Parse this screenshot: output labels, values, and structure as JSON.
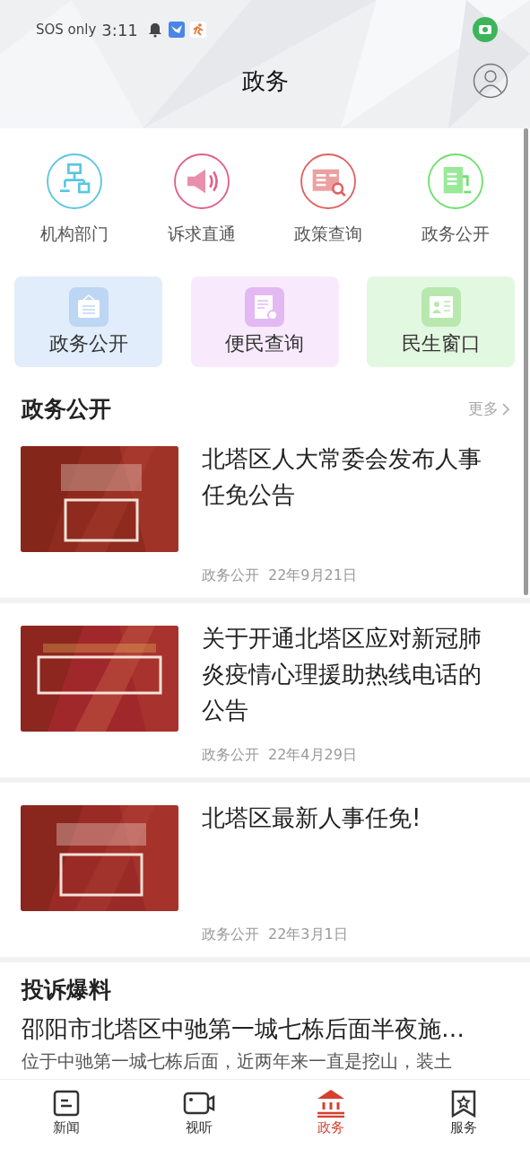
{
  "status_bar": {
    "carrier": "SOS only",
    "time": "3:11"
  },
  "header": {
    "title": "政务"
  },
  "shortcuts": [
    {
      "label": "机构部门",
      "kind": "org",
      "color": "#5cc6e0"
    },
    {
      "label": "诉求直通",
      "kind": "speaker",
      "color": "#e0608a"
    },
    {
      "label": "政策查询",
      "kind": "policy",
      "color": "#e06262"
    },
    {
      "label": "政务公开",
      "kind": "doc",
      "color": "#6ee06e"
    }
  ],
  "cards": [
    {
      "label": "政务公开",
      "kind": "notice",
      "color": "#e1edfb"
    },
    {
      "label": "便民查询",
      "kind": "search",
      "color": "#f8eafc"
    },
    {
      "label": "民生窗口",
      "kind": "window",
      "color": "#e3f8e0"
    }
  ],
  "section": {
    "title": "政务公开",
    "more": "更多"
  },
  "articles": [
    {
      "title": "北塔区人大常委会发布人事任免公告",
      "source": "政务公开",
      "date": "22年9月21日"
    },
    {
      "title": "关于开通北塔区应对新冠肺炎疫情心理援助热线电话的公告",
      "source": "政务公开",
      "date": "22年4月29日"
    },
    {
      "title": "北塔区最新人事任免!",
      "source": "政务公开",
      "date": "22年3月1日"
    }
  ],
  "complaints": {
    "title": "投诉爆料",
    "headline": "邵阳市北塔区中驰第一城七栋后面半夜施…",
    "body": "位于中驰第一城七栋后面，近两年来一直是挖山，装土"
  },
  "tabs": [
    {
      "label": "新闻",
      "kind": "news",
      "selected": false
    },
    {
      "label": "视听",
      "kind": "video",
      "selected": false
    },
    {
      "label": "政务",
      "kind": "gov",
      "selected": true
    },
    {
      "label": "服务",
      "kind": "service",
      "selected": false
    }
  ]
}
